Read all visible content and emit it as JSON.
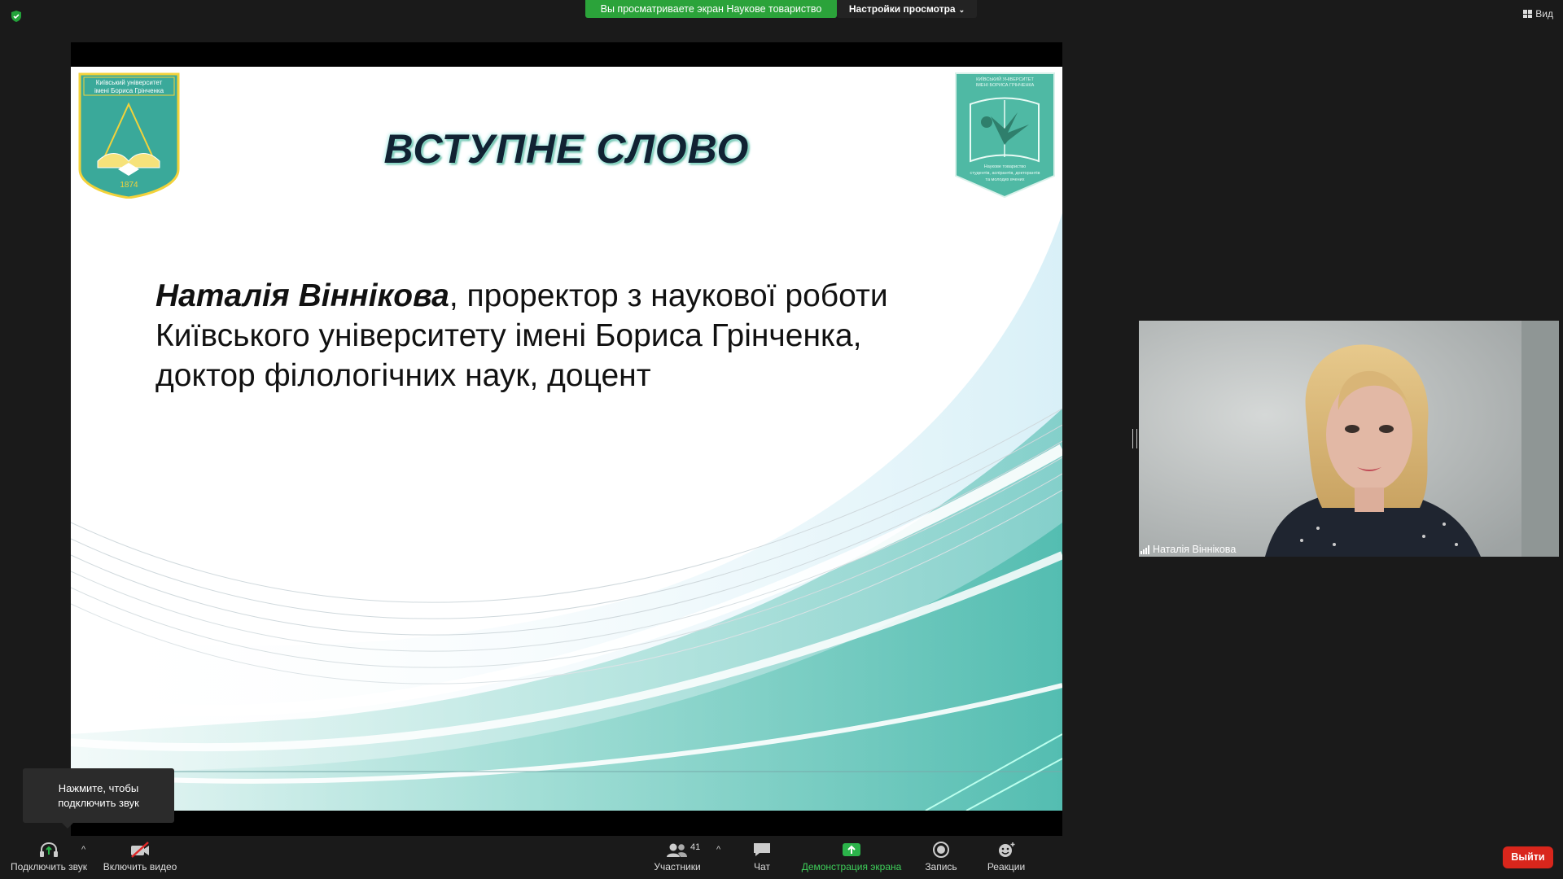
{
  "top": {
    "share_banner": "Вы просматриваете экран Наукове товариство",
    "view_settings": "Настройки просмотра",
    "view_label": "Вид"
  },
  "slide": {
    "title": "ВСТУПНЕ СЛОВО",
    "name": "Наталія Віннікова",
    "line1_rest": ", проректор з наукової роботи",
    "line2": "Київського університету імені Бориса Грінченка,",
    "line3": "доктор філологічних наук, доцент",
    "logo_left": {
      "top_text_1": "Київський університет",
      "top_text_2": "імені Бориса Грінченка",
      "year": "1874"
    },
    "logo_right": {
      "top_text_1": "КИЇВСЬКИЙ УНІВЕРСИТЕТ",
      "top_text_2": "ІМЕНІ БОРИСА ГРІНЧЕНКА",
      "bottom_1": "Наукове товариство",
      "bottom_2": "студентів, аспірантів, докторантів",
      "bottom_3": "та молодих вчених"
    },
    "colors": {
      "teal": "#4fc1b0",
      "title_shadow": "#4a8"
    }
  },
  "video": {
    "participant_name": "Наталія Віннікова"
  },
  "tooltip": {
    "line1": "Нажмите, чтобы",
    "line2": "подключить звук"
  },
  "toolbar": {
    "audio": "Подключить звук",
    "video": "Включить видео",
    "participants": "Участники",
    "participants_count": "41",
    "chat": "Чат",
    "share": "Демонстрация экрана",
    "record": "Запись",
    "reactions": "Реакции",
    "leave": "Выйти"
  }
}
